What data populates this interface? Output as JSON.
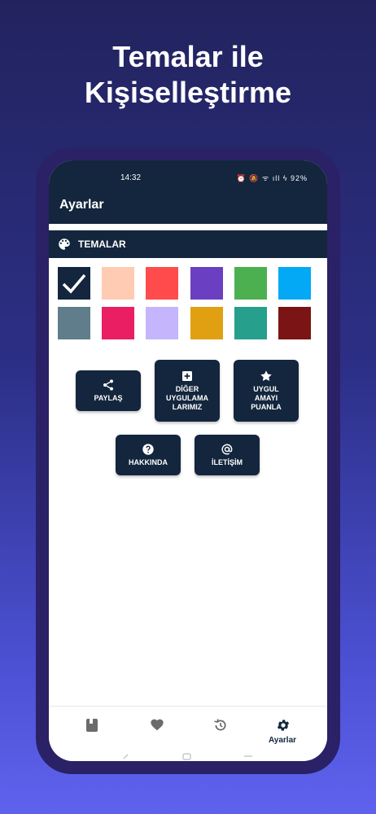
{
  "headline": {
    "line1": "Temalar ile",
    "line2": "Kişiselleştirme"
  },
  "status": {
    "time": "14:32",
    "icons": "⏰ 🔕 ᯤ ıll ϟ",
    "battery": "92%"
  },
  "appbar": {
    "title": "Ayarlar"
  },
  "themes_section": {
    "title": "TEMALAR",
    "icon": "palette-icon"
  },
  "swatches": [
    {
      "color": "#13263d",
      "selected": true
    },
    {
      "color": "#ffccb3",
      "selected": false
    },
    {
      "color": "#ff4b4b",
      "selected": false
    },
    {
      "color": "#6b3fc1",
      "selected": false
    },
    {
      "color": "#4caf50",
      "selected": false
    },
    {
      "color": "#03a9f4",
      "selected": false
    },
    {
      "color": "#607d8b",
      "selected": false
    },
    {
      "color": "#e91e63",
      "selected": false
    },
    {
      "color": "#c4b5fd",
      "selected": false
    },
    {
      "color": "#e0a012",
      "selected": false
    },
    {
      "color": "#26a08c",
      "selected": false
    },
    {
      "color": "#7b1414",
      "selected": false
    }
  ],
  "buttons": {
    "share": {
      "label": "PAYLAŞ",
      "icon": "share-icon"
    },
    "other_apps": {
      "label": "DİĞER\nUYGULAMA\nLARIMIZ",
      "icon": "add-box-icon"
    },
    "rate": {
      "label": "UYGUL\nAMAYI\nPUANLA",
      "icon": "star-icon"
    },
    "about": {
      "label": "HAKKINDA",
      "icon": "help-icon"
    },
    "contact": {
      "label": "İLETİŞİM",
      "icon": "at-icon"
    }
  },
  "bottom_nav": {
    "items": [
      {
        "icon": "book-icon",
        "label": ""
      },
      {
        "icon": "heart-icon",
        "label": ""
      },
      {
        "icon": "history-icon",
        "label": ""
      },
      {
        "icon": "gear-icon",
        "label": "Ayarlar",
        "active": true
      }
    ]
  },
  "colors": {
    "primary": "#13263d",
    "background_top": "#22235e",
    "background_bottom": "#5f62ee",
    "phone_frame": "#2a2166"
  }
}
